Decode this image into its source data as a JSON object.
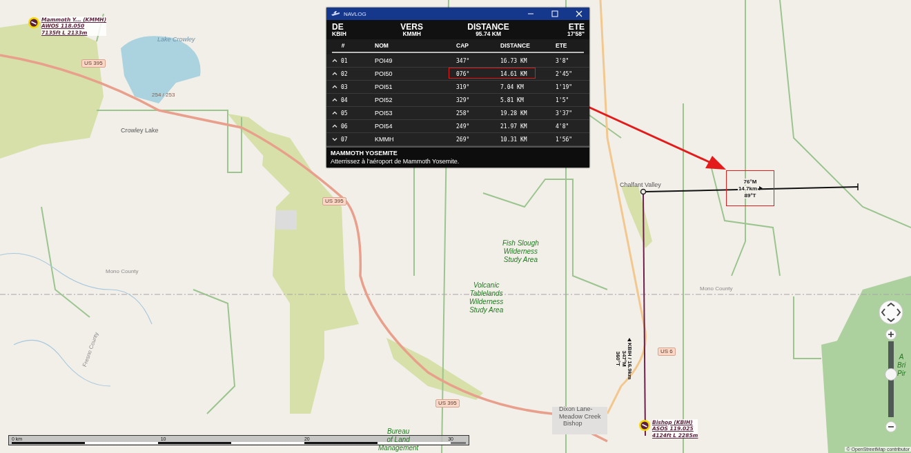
{
  "navlog": {
    "title": "NAVLOG",
    "summary": [
      {
        "label": "DE",
        "value": "KBIH"
      },
      {
        "label": "VERS",
        "value": "KMMH"
      },
      {
        "label": "DISTANCE",
        "value": "95.74 KM"
      },
      {
        "label": "ETE",
        "value": "17'58\""
      }
    ],
    "columns": [
      "#",
      "NOM",
      "CAP",
      "DISTANCE",
      "ETE"
    ],
    "rows": [
      {
        "number": "01",
        "name": "POI49",
        "cap": "347°",
        "distance": "16.73 KM",
        "ete": "3'8\"",
        "expanded": false,
        "highlighted": false
      },
      {
        "number": "02",
        "name": "POI50",
        "cap": "076°",
        "distance": "14.61 KM",
        "ete": "2'45\"",
        "expanded": false,
        "highlighted": true
      },
      {
        "number": "03",
        "name": "POI51",
        "cap": "319°",
        "distance": "7.04 KM",
        "ete": "1'19\"",
        "expanded": false,
        "highlighted": false
      },
      {
        "number": "04",
        "name": "POI52",
        "cap": "329°",
        "distance": "5.81 KM",
        "ete": "1'5\"",
        "expanded": false,
        "highlighted": false
      },
      {
        "number": "05",
        "name": "POI53",
        "cap": "258°",
        "distance": "19.28 KM",
        "ete": "3'37\"",
        "expanded": false,
        "highlighted": false
      },
      {
        "number": "06",
        "name": "POI54",
        "cap": "249°",
        "distance": "21.97 KM",
        "ete": "4'8\"",
        "expanded": false,
        "highlighted": false
      },
      {
        "number": "07",
        "name": "KMMH",
        "cap": "269°",
        "distance": "10.31 KM",
        "ete": "1'56\"",
        "expanded": true,
        "highlighted": false
      }
    ],
    "footer": {
      "title": "MAMMOTH YOSEMITE",
      "text": "Atterrissez à l'aéroport de Mammoth Yosemite."
    }
  },
  "map": {
    "labels": [
      {
        "kind": "water",
        "text": "Lake Crowley"
      },
      {
        "kind": "road",
        "text": "US 395"
      },
      {
        "kind": "exit",
        "text": "254 / 253"
      },
      {
        "kind": "place",
        "text": "Crowley Lake"
      },
      {
        "kind": "road",
        "text": "US 395"
      },
      {
        "kind": "county",
        "text": "Mono County"
      },
      {
        "kind": "county",
        "text": "Fresno County"
      },
      {
        "kind": "county",
        "text": "Mono County"
      },
      {
        "kind": "place",
        "text": "Chalfant Valley"
      },
      {
        "kind": "area",
        "text": "Fish Slough\nWilderness\nStudy Area"
      },
      {
        "kind": "area",
        "text": "Volcanic\nTablelands\nWilderness\nStudy Area"
      },
      {
        "kind": "road",
        "text": "US 6"
      },
      {
        "kind": "road",
        "text": "US 395"
      },
      {
        "kind": "area",
        "text": "Bureau\nof Land\nManagement"
      },
      {
        "kind": "place",
        "text": "Dixon Lane-\nMeadow Creek"
      },
      {
        "kind": "place",
        "text": "Bishop"
      },
      {
        "kind": "area",
        "text": "A\nBri\nPir"
      }
    ],
    "airports": [
      {
        "name": "Mammoth Y... (KMMH)",
        "frequency": "AWOS 118.050",
        "elevation": "7135ft L 2133m"
      },
      {
        "name": "Bishop (KBIH)",
        "frequency": "ASOS 119.025",
        "elevation": "4124ft L 2285m"
      }
    ],
    "legs": [
      {
        "route": "KBIH / 16.9km",
        "magnetic": "347°M",
        "true": "360°T"
      },
      {
        "route": "14.7km",
        "magnetic": "76°M",
        "true": "89°T",
        "highlighted": true
      }
    ],
    "scale_bar": {
      "labels": [
        "0 km",
        "10",
        "20",
        "30"
      ]
    },
    "zoom": {
      "level": 0.58
    },
    "attribution": "© OpenStreetMap contributor"
  }
}
